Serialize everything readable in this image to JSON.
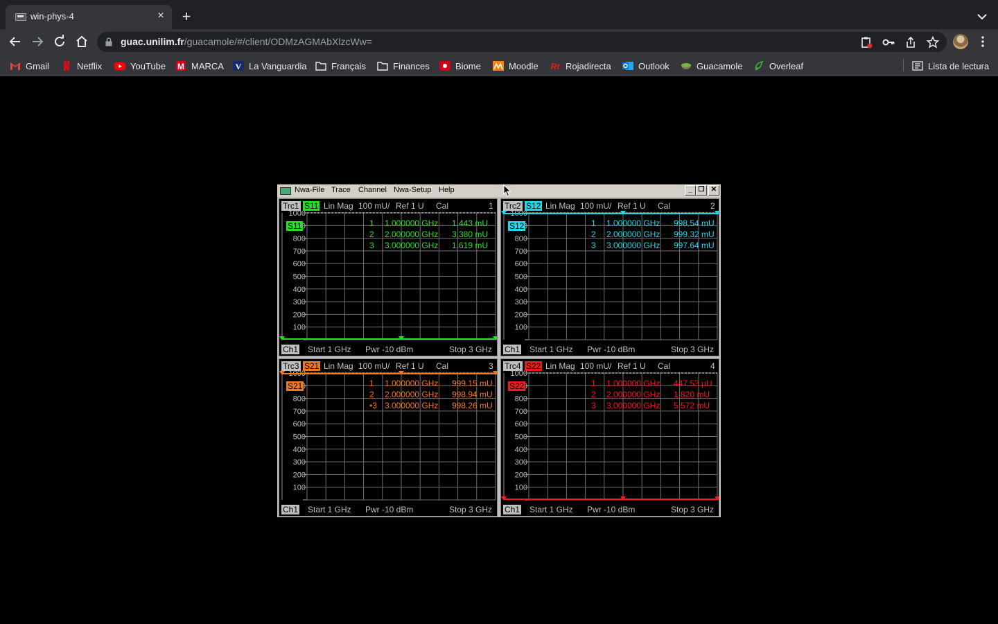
{
  "browser": {
    "tab_title": "win-phys-4",
    "new_tab": "+",
    "close": "×",
    "url_host": "guac.unilim.fr",
    "url_path": "/guacamole/#/client/ODMzAGMAbXlzcWw=",
    "bookmarks": [
      {
        "label": "Gmail",
        "icon": "gmail-icon",
        "color": "#ea4335"
      },
      {
        "label": "Netflix",
        "icon": "netflix-icon",
        "color": "#e50914"
      },
      {
        "label": "YouTube",
        "icon": "youtube-icon",
        "color": "#ff0000"
      },
      {
        "label": "MARCA",
        "icon": "marca-icon",
        "color": "#d0021b"
      },
      {
        "label": "La Vanguardia",
        "icon": "lavanguardia-icon",
        "color": "#1a2b6b"
      },
      {
        "label": "Français",
        "icon": "folder-icon",
        "color": "#e8eaed"
      },
      {
        "label": "Finances",
        "icon": "folder-icon",
        "color": "#e8eaed"
      },
      {
        "label": "Biome",
        "icon": "biome-icon",
        "color": "#d0021b"
      },
      {
        "label": "Moodle",
        "icon": "moodle-icon",
        "color": "#f98012"
      },
      {
        "label": "Rojadirecta",
        "icon": "rojadirecta-icon",
        "color": "#e0201b"
      },
      {
        "label": "Outlook",
        "icon": "outlook-icon",
        "color": "#0078d4"
      },
      {
        "label": "Guacamole",
        "icon": "guacamole-icon",
        "color": "#7cb342"
      },
      {
        "label": "Overleaf",
        "icon": "overleaf-icon",
        "color": "#47a141"
      }
    ],
    "reading_list": "Lista de lectura"
  },
  "app": {
    "menu": [
      "Nwa-File",
      "Trace",
      "Channel",
      "Nwa-Setup",
      "Help"
    ],
    "window_buttons": {
      "minimize": "_",
      "restore": "❐",
      "close": "✕"
    },
    "traces": [
      {
        "trc": "Trc1",
        "param": "S11",
        "format": "Lin Mag",
        "scale": "100 mU/",
        "ref": "Ref 1 U",
        "cal": "Cal",
        "num": "1",
        "color": "#22e022",
        "markers": [
          {
            "n": "1",
            "freq": "1.000000 GHz",
            "val": "1.443 mU"
          },
          {
            "n": "2",
            "freq": "2.000000 GHz",
            "val": "3.380 mU"
          },
          {
            "n": "3",
            "freq": "3.000000 GHz",
            "val": "1.619 mU"
          }
        ],
        "ch": "Ch1",
        "start": "Start 1 GHz",
        "pwr": "Pwr -10 dBm",
        "stop": "Stop 3 GHz",
        "level": "low"
      },
      {
        "trc": "Trc2",
        "param": "S12",
        "format": "Lin Mag",
        "scale": "100 mU/",
        "ref": "Ref 1 U",
        "cal": "Cal",
        "num": "2",
        "color": "#22d8e8",
        "markers": [
          {
            "n": "1",
            "freq": "1.000000 GHz",
            "val": "998.54 mU"
          },
          {
            "n": "2",
            "freq": "2.000000 GHz",
            "val": "999.32 mU"
          },
          {
            "n": "3",
            "freq": "3.000000 GHz",
            "val": "997.64 mU"
          }
        ],
        "ch": "Ch1",
        "start": "Start 1 GHz",
        "pwr": "Pwr -10 dBm",
        "stop": "Stop 3 GHz",
        "level": "high"
      },
      {
        "trc": "Trc3",
        "param": "S21",
        "format": "Lin Mag",
        "scale": "100 mU/",
        "ref": "Ref 1 U",
        "cal": "Cal",
        "num": "3",
        "color": "#f07820",
        "markers": [
          {
            "n": "1",
            "freq": "1.000000 GHz",
            "val": "999.15 mU"
          },
          {
            "n": "2",
            "freq": "2.000000 GHz",
            "val": "998.94 mU"
          },
          {
            "n": "•3",
            "freq": "3.000000 GHz",
            "val": "998.26 mU"
          }
        ],
        "ch": "Ch1",
        "start": "Start 1 GHz",
        "pwr": "Pwr -10 dBm",
        "stop": "Stop 3 GHz",
        "level": "high"
      },
      {
        "trc": "Trc4",
        "param": "S22",
        "format": "Lin Mag",
        "scale": "100 mU/",
        "ref": "Ref 1 U",
        "cal": "Cal",
        "num": "4",
        "color": "#ee1c1c",
        "markers": [
          {
            "n": "1",
            "freq": "1.000000 GHz",
            "val": "447.53 µU"
          },
          {
            "n": "2",
            "freq": "2.000000 GHz",
            "val": "1.820 mU"
          },
          {
            "n": "3",
            "freq": "3.000000 GHz",
            "val": "5.572 mU"
          }
        ],
        "ch": "Ch1",
        "start": "Start 1 GHz",
        "pwr": "Pwr -10 dBm",
        "stop": "Stop 3 GHz",
        "level": "low"
      }
    ],
    "y_ticks": [
      "1000",
      "900",
      "800",
      "700",
      "600",
      "500",
      "400",
      "300",
      "200",
      "100"
    ]
  }
}
